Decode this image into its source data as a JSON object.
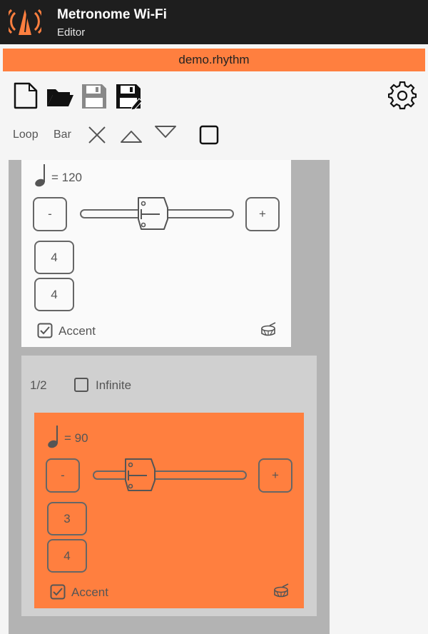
{
  "app": {
    "title": "Metronome Wi-Fi",
    "subtitle": "Editor"
  },
  "file": {
    "name": "demo.rhythm"
  },
  "toolbar": {
    "loop_label": "Loop",
    "bar_label": "Bar"
  },
  "bar1": {
    "tempo": "= 120",
    "minus": "-",
    "plus": "+",
    "beats": "4",
    "unit": "4",
    "accent_label": "Accent",
    "accent_checked": true
  },
  "group": {
    "counter": "1/2",
    "infinite_label": "Infinite",
    "infinite_checked": false
  },
  "bar2": {
    "tempo": "= 90",
    "minus": "-",
    "plus": "+",
    "beats": "3",
    "unit": "4",
    "accent_label": "Accent",
    "accent_checked": true
  },
  "colors": {
    "accent": "#ff7f3f",
    "appbar": "#1e1e1e"
  }
}
